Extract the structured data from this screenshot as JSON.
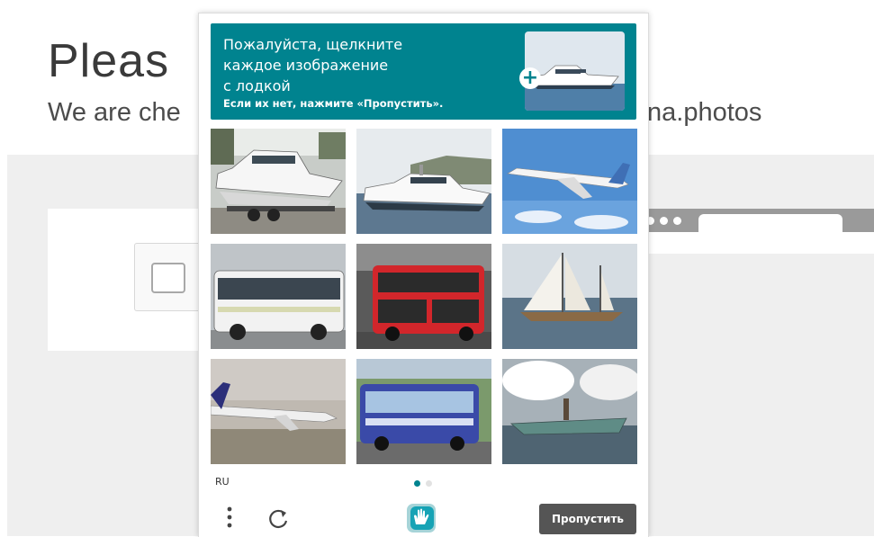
{
  "background": {
    "title": "Pleas",
    "subtitle_left": "We are che",
    "subtitle_right": "na.photos"
  },
  "captcha": {
    "prompt": {
      "line1": "Пожалуйста, щелкните",
      "line2": "каждое изображение",
      "line3": "с лодкой",
      "hint": "Если их нет, нажмите «Пропустить».",
      "accent_color": "#00838f"
    },
    "tiles": [
      {
        "subject": "boat"
      },
      {
        "subject": "boat"
      },
      {
        "subject": "airplane"
      },
      {
        "subject": "bus"
      },
      {
        "subject": "bus"
      },
      {
        "subject": "sailboat"
      },
      {
        "subject": "airplane"
      },
      {
        "subject": "bus"
      },
      {
        "subject": "boat"
      }
    ],
    "language": "RU",
    "page_indicator": {
      "current": 1,
      "total": 2
    },
    "footer": {
      "menu_icon": "more-vertical-icon",
      "refresh_icon": "refresh-icon",
      "logo_icon": "hcaptcha-hand-logo-icon",
      "skip_label": "Пропустить"
    }
  }
}
